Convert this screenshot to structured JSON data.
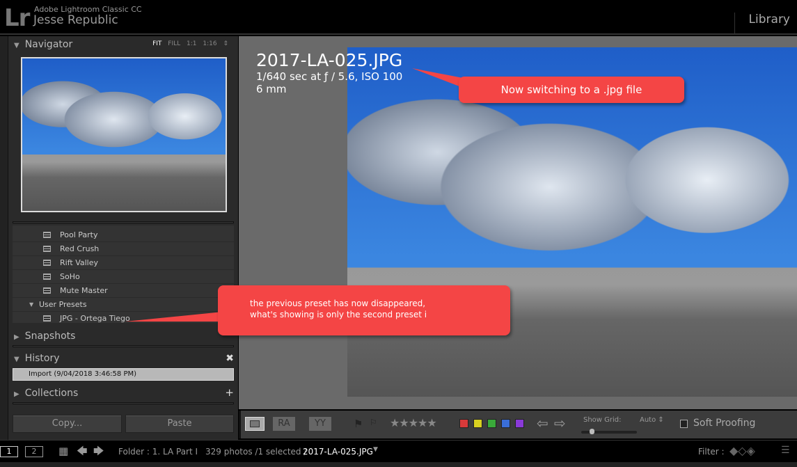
{
  "header": {
    "logo": "Lr",
    "app_name": "Adobe Lightroom Classic CC",
    "user_name": "Jesse Republic",
    "module": "Library"
  },
  "navigator": {
    "title": "Navigator",
    "options": [
      "FIT",
      "FILL",
      "1:1",
      "1:16 ⇕"
    ],
    "active": "FIT"
  },
  "presets": {
    "items": [
      {
        "label": "Pool Party",
        "type": "preset"
      },
      {
        "label": "Red Crush",
        "type": "preset"
      },
      {
        "label": "Rift Valley",
        "type": "preset"
      },
      {
        "label": "SoHo",
        "type": "preset"
      },
      {
        "label": "Mute Master",
        "type": "preset"
      },
      {
        "label": "User Presets",
        "type": "folder"
      },
      {
        "label": "JPG - Ortega Tiego",
        "type": "preset"
      }
    ]
  },
  "panels": {
    "snapshots": "Snapshots",
    "history": "History",
    "history_item": "Import (9/04/2018 3:46:58 PM)",
    "collections": "Collections"
  },
  "buttons": {
    "copy": "Copy...",
    "paste": "Paste"
  },
  "photo_info": {
    "filename": "2017-LA-025.JPG",
    "exif_line1": "1/640 sec at ƒ / 5.6, ISO 100",
    "exif_line2": "6 mm"
  },
  "annotations": {
    "callout1": "Now switching to a .jpg file",
    "callout2_line1": "the previous preset has now disappeared,",
    "callout2_line2": "what's showing is only the second preset i"
  },
  "toolbar": {
    "show_grid": "Show Grid:",
    "grid_value": "Auto ⇕",
    "soft_proofing": "Soft Proofing",
    "stars": "★★★★★",
    "color_labels": [
      "#d83a3a",
      "#d8d020",
      "#3aaa3a",
      "#3a6ed8",
      "#8a3ad8"
    ]
  },
  "filmstrip": {
    "screen1": "1",
    "screen2": "2",
    "folder": "Folder : 1. LA Part I",
    "count": "329 photos /1 selected /",
    "current_file": "2017-LA-025.JPG",
    "filter": "Filter :"
  }
}
